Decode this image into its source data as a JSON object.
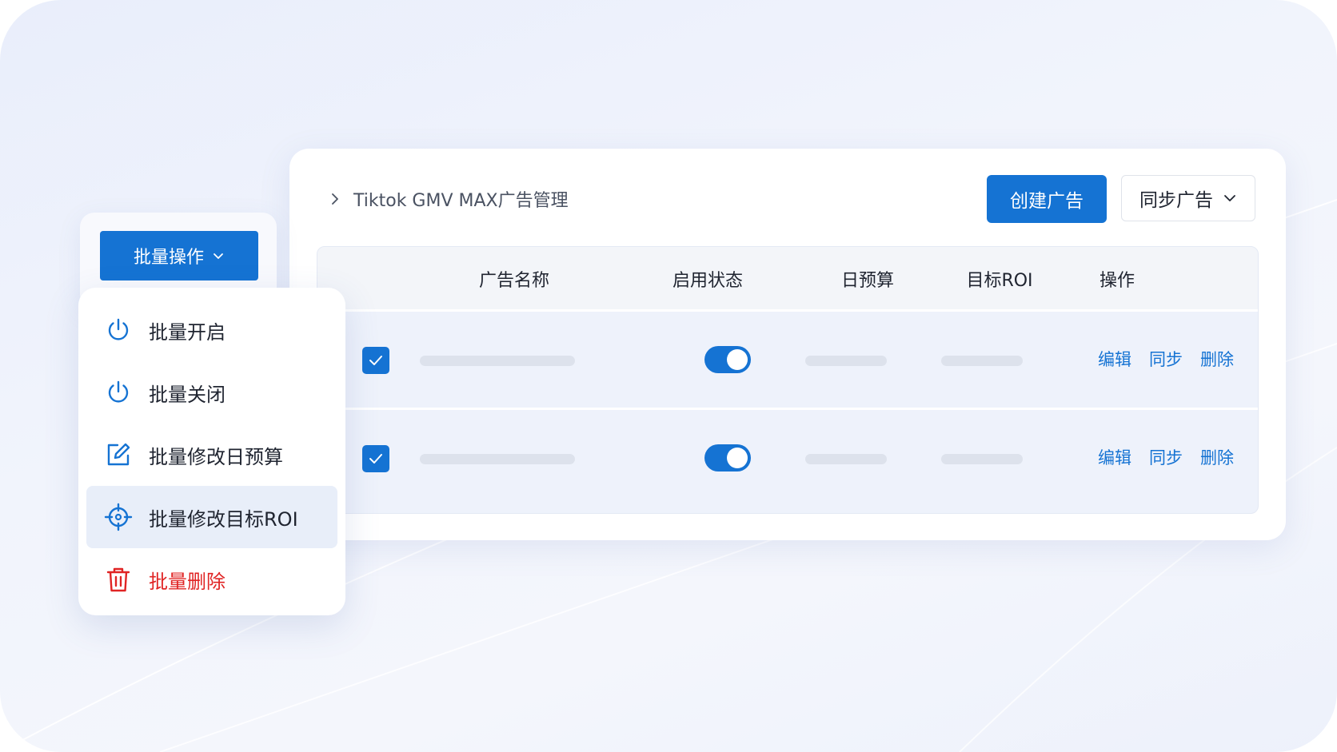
{
  "colors": {
    "primary": "#1573d3",
    "danger": "#e02424",
    "text": "#1f2430",
    "muted": "#4a5262",
    "skeleton": "#dde2ec",
    "row_bg": "#eef2fb",
    "active_bg": "#e8eef9"
  },
  "header": {
    "breadcrumb": "Tiktok GMV MAX广告管理",
    "breadcrumb_icon": "chevron-right-icon",
    "create_button": "创建广告",
    "sync_button": "同步广告",
    "sync_icon": "chevron-down-icon"
  },
  "table": {
    "columns": [
      "广告名称",
      "启用状态",
      "日预算",
      "目标ROI",
      "操作"
    ],
    "rows": [
      {
        "checked": true,
        "enabled": true,
        "actions": [
          "编辑",
          "同步",
          "删除"
        ]
      },
      {
        "checked": true,
        "enabled": true,
        "actions": [
          "编辑",
          "同步",
          "删除"
        ]
      }
    ]
  },
  "batch": {
    "button_label": "批量操作",
    "button_icon": "chevron-down-icon",
    "menu": [
      {
        "label": "批量开启",
        "icon": "power-icon",
        "active": false,
        "danger": false
      },
      {
        "label": "批量关闭",
        "icon": "power-icon",
        "active": false,
        "danger": false
      },
      {
        "label": "批量修改日预算",
        "icon": "edit-icon",
        "active": false,
        "danger": false
      },
      {
        "label": "批量修改目标ROI",
        "icon": "target-icon",
        "active": true,
        "danger": false
      },
      {
        "label": "批量删除",
        "icon": "trash-icon",
        "active": false,
        "danger": true
      }
    ]
  }
}
